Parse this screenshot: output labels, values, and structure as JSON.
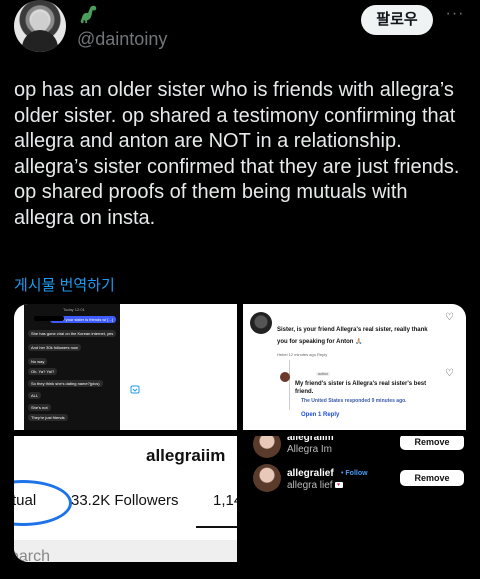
{
  "header": {
    "handle": "@daintoiny",
    "follow_label": "팔로우",
    "more_label": "···",
    "avatar_icon": "user-avatar",
    "name_icon": "dinosaur-emoji-icon"
  },
  "tweet": {
    "text": "op has an older sister who is friends with allegra’s older sister. op shared a testimony confirming that allegra and anton are NOT in a relationship. allegra’s sister confirmed that they are just friends. op shared proofs of them being mutuals with allegra on insta.",
    "translate_label": "게시물 번역하기"
  },
  "media": {
    "image1": {
      "messages": [
        "Today 12:01",
        "-Ask if your sister is friends w/ [...]",
        "She has gone viral on the Korean internet, yes",
        "And her 30k followers now",
        "No way",
        "Oh. Ya? Ya!?",
        "So they think she's dating name?(pics)",
        "ALL",
        "She's not",
        "They're just friends"
      ],
      "icon": "app-badge-icon"
    },
    "image2": {
      "question": "Sister, is your friend Allegra's real sister, really thank you for speaking for Anton 🙏🏼",
      "question_meta": "Hebei 12 minutes ago Reply",
      "author_tag": "author",
      "reply": "My friend's sister is Allegra's real sister's best friend.",
      "responded": "The United States responded 9 minutes ago.",
      "open_reply": "Open 1 Reply"
    },
    "image3": {
      "username": "allegraiim",
      "stat1": "tual",
      "stat2": "33.2K Followers",
      "stat3": "1,14",
      "search": "earch"
    },
    "image4": {
      "rows": [
        {
          "name": "allegraiim",
          "sub": "Allegra Im",
          "button": "Remove"
        },
        {
          "name": "allegralief",
          "follow": "• Follow",
          "sub": "allegra lief",
          "button": "Remove"
        }
      ]
    }
  }
}
